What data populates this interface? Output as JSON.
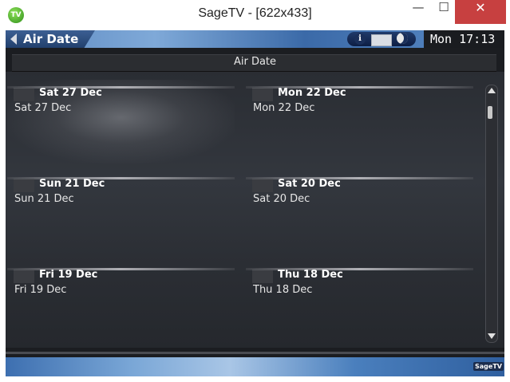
{
  "window": {
    "title": "SageTV - [622x433]",
    "app_icon": "TV",
    "minimize_glyph": "—",
    "maximize_glyph": "☐",
    "close_glyph": "✕"
  },
  "topbar": {
    "title": "Air Date",
    "clock": "Mon 17:13",
    "icons": [
      "back-arrow-icon",
      "info-icon",
      "mail-icon",
      "moon-icon"
    ]
  },
  "header": {
    "label": "Air Date"
  },
  "items": [
    {
      "title": "Sat 27 Dec",
      "subtitle": "Sat 27 Dec",
      "selected": true
    },
    {
      "title": "Mon 22 Dec",
      "subtitle": "Mon 22 Dec",
      "selected": false
    },
    {
      "title": "Sun 21 Dec",
      "subtitle": "Sun 21 Dec",
      "selected": false
    },
    {
      "title": "Sat 20 Dec",
      "subtitle": "Sat 20 Dec",
      "selected": false
    },
    {
      "title": "Fri 19 Dec",
      "subtitle": "Fri 19 Dec",
      "selected": false
    },
    {
      "title": "Thu 18 Dec",
      "subtitle": "Thu 18 Dec",
      "selected": false
    }
  ],
  "footer": {
    "logo": "SageTV"
  },
  "colors": {
    "accent_blue": "#3b6aa8",
    "background": "#1b1d21",
    "close_button": "#c74040"
  }
}
